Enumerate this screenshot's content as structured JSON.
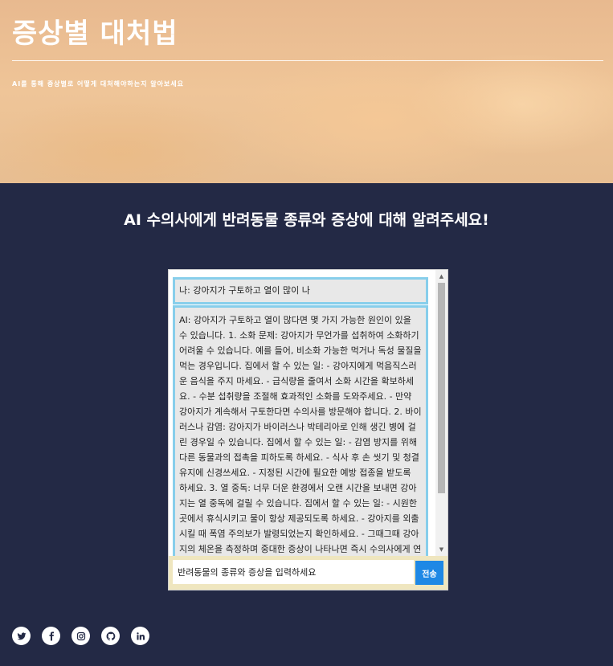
{
  "hero": {
    "title": "증상별 대처법",
    "subtitle": "AI를 통해 증상별로 어떻게 대처해야하는지 알아보세요"
  },
  "main": {
    "heading": "AI 수의사에게 반려동물 종류와 증상에 대해 알려주세요!"
  },
  "chat": {
    "messages": [
      {
        "role": "user",
        "text": "나: 강아지가 구토하고 열이 많이 나"
      },
      {
        "role": "ai",
        "text": "AI: 강아지가 구토하고 열이 많다면 몇 가지 가능한 원인이 있을 수 있습니다. 1. 소화 문제: 강아지가 무언가를 섭취하여 소화하기 어려울 수 있습니다. 예를 들어, 비소화 가능한 먹거나 독성 물질을 먹는 경우입니다. 집에서 할 수 있는 일: - 강아지에게 먹음직스러운 음식을 주지 마세요. - 급식량을 줄여서 소화 시간을 확보하세요. - 수분 섭취량을 조절해 효과적인 소화를 도와주세요. - 만약 강아지가 계속해서 구토한다면 수의사를 방문해야 합니다. 2. 바이러스나 감염: 강아지가 바이러스나 박테리아로 인해 생긴 병에 걸린 경우일 수 있습니다. 집에서 할 수 있는 일: - 감염 방지를 위해 다른 동물과의 접촉을 피하도록 하세요. - 식사 후 손 씻기 및 청결 유지에 신경쓰세요. - 지정된 시간에 필요한 예방 접종을 받도록 하세요. 3. 열 중독: 너무 더운 환경에서 오랜 시간을 보내면 강아지는 열 중독에 걸릴 수 있습니다. 집에서 할 수 있는 일: - 시원한 곳에서 휴식시키고 물이 항상 제공되도록 하세요. - 강아지를 외출시킬 때 폭염 주의보가 발령되었는지 확인하세요. - 그때그때 강아지의 체온을 측정하며 중대한 증상이 나타나면 즉시 수의사에게 연락하세요."
      }
    ],
    "input_placeholder": "반려동물의 종류와 증상을 입력하세요",
    "send_label": "전송"
  },
  "social": {
    "icons": [
      "twitter-icon",
      "facebook-icon",
      "instagram-icon",
      "github-icon",
      "linkedin-icon"
    ]
  },
  "colors": {
    "background": "#232945",
    "message_border": "#87ceeb",
    "send_button": "#1e88e5",
    "input_bar": "#efe6bf"
  }
}
